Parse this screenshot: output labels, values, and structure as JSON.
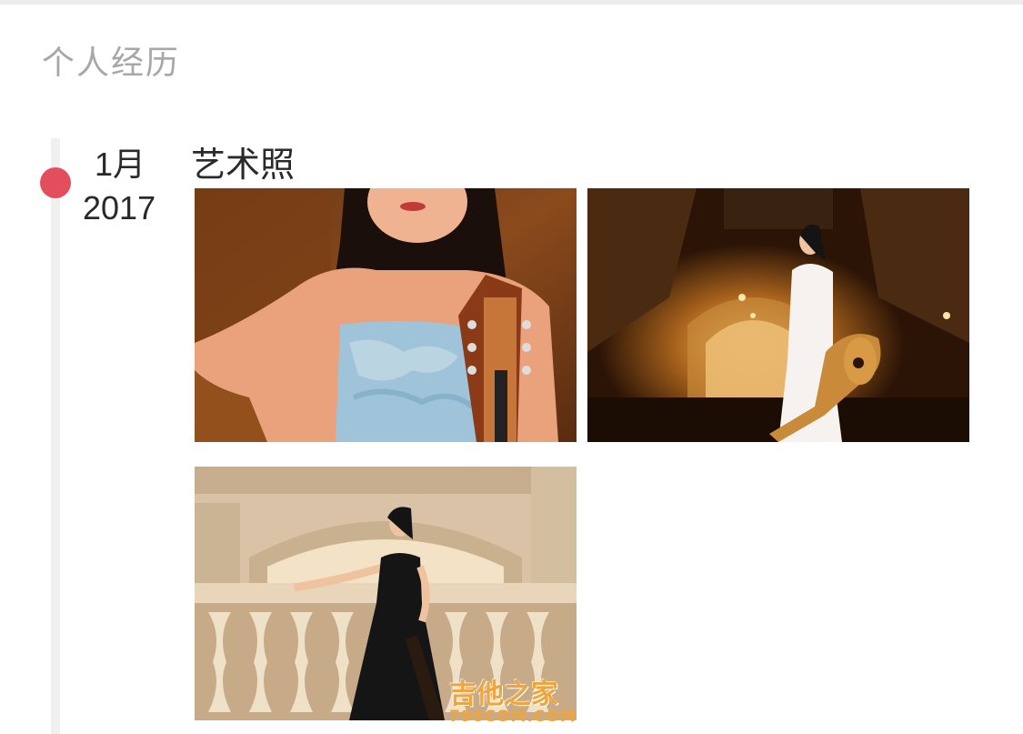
{
  "section": {
    "title": "个人经历"
  },
  "timeline": {
    "entry": {
      "month": "1月",
      "year": "2017",
      "title": "艺术照",
      "photos": [
        {
          "icon": "photo-guitarist-closeup"
        },
        {
          "icon": "photo-guitarist-white-dress-corridor"
        },
        {
          "icon": "photo-guitarist-black-dress-balustrade"
        }
      ]
    }
  },
  "watermark": {
    "text": "吉他之家",
    "sub": "798COM.COM"
  },
  "colors": {
    "accent_dot": "#e24e5c",
    "timeline_line": "#f0f0f0",
    "section_title": "#a7a7a7",
    "text": "#2a2a2a",
    "watermark": "#f0a43a"
  }
}
